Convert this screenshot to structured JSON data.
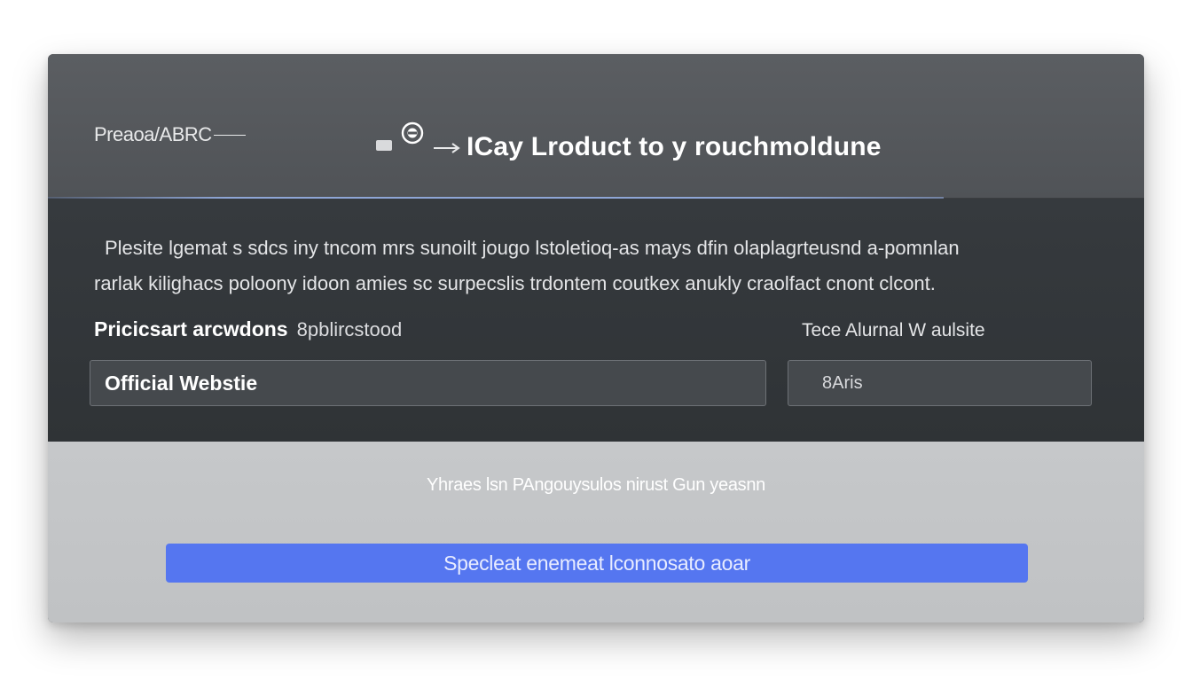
{
  "header": {
    "brand": "Preaoa/ABRC",
    "title": "ICay Lroduct to y rouchmoldune"
  },
  "body": {
    "description_line1": "Plesite lgemat s sdcs iny tncom mrs sunoilt jougo lstoletioq-as mays dfin olaplagrteusnd a-pomnlan",
    "description_line2": "rarlak kilighacs poloony idoon amies sc surpecslis trdontem coutkex anukly craolfact cnont clcont.",
    "field_left": {
      "label_strong": "Pricicsart arcwdons",
      "label_light": "8pblircstood",
      "value": "Official Webstie"
    },
    "field_right": {
      "label": "Tece Alurnal W aulsite",
      "value": "8Aris"
    }
  },
  "footer": {
    "note": "Yhraes lsn PAngouysulos nirust Gun yeasnn",
    "button_label": "Specleat enemeat lconnosato aoar"
  },
  "colors": {
    "header_bg": "#55585c",
    "body_bg": "#33373a",
    "footer_bg": "#c3c5c7",
    "accent": "#5576f0",
    "divider": "#8ea6d6"
  }
}
